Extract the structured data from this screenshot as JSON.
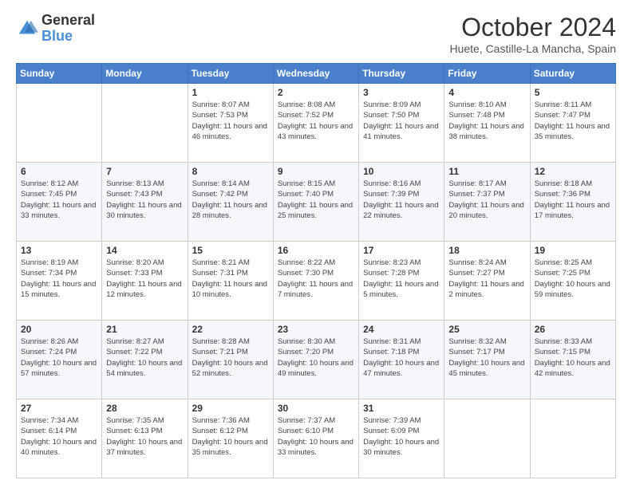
{
  "logo": {
    "general": "General",
    "blue": "Blue"
  },
  "header": {
    "month": "October 2024",
    "location": "Huete, Castille-La Mancha, Spain"
  },
  "weekdays": [
    "Sunday",
    "Monday",
    "Tuesday",
    "Wednesday",
    "Thursday",
    "Friday",
    "Saturday"
  ],
  "weeks": [
    [
      {
        "day": "",
        "info": ""
      },
      {
        "day": "",
        "info": ""
      },
      {
        "day": "1",
        "info": "Sunrise: 8:07 AM\nSunset: 7:53 PM\nDaylight: 11 hours and 46 minutes."
      },
      {
        "day": "2",
        "info": "Sunrise: 8:08 AM\nSunset: 7:52 PM\nDaylight: 11 hours and 43 minutes."
      },
      {
        "day": "3",
        "info": "Sunrise: 8:09 AM\nSunset: 7:50 PM\nDaylight: 11 hours and 41 minutes."
      },
      {
        "day": "4",
        "info": "Sunrise: 8:10 AM\nSunset: 7:48 PM\nDaylight: 11 hours and 38 minutes."
      },
      {
        "day": "5",
        "info": "Sunrise: 8:11 AM\nSunset: 7:47 PM\nDaylight: 11 hours and 35 minutes."
      }
    ],
    [
      {
        "day": "6",
        "info": "Sunrise: 8:12 AM\nSunset: 7:45 PM\nDaylight: 11 hours and 33 minutes."
      },
      {
        "day": "7",
        "info": "Sunrise: 8:13 AM\nSunset: 7:43 PM\nDaylight: 11 hours and 30 minutes."
      },
      {
        "day": "8",
        "info": "Sunrise: 8:14 AM\nSunset: 7:42 PM\nDaylight: 11 hours and 28 minutes."
      },
      {
        "day": "9",
        "info": "Sunrise: 8:15 AM\nSunset: 7:40 PM\nDaylight: 11 hours and 25 minutes."
      },
      {
        "day": "10",
        "info": "Sunrise: 8:16 AM\nSunset: 7:39 PM\nDaylight: 11 hours and 22 minutes."
      },
      {
        "day": "11",
        "info": "Sunrise: 8:17 AM\nSunset: 7:37 PM\nDaylight: 11 hours and 20 minutes."
      },
      {
        "day": "12",
        "info": "Sunrise: 8:18 AM\nSunset: 7:36 PM\nDaylight: 11 hours and 17 minutes."
      }
    ],
    [
      {
        "day": "13",
        "info": "Sunrise: 8:19 AM\nSunset: 7:34 PM\nDaylight: 11 hours and 15 minutes."
      },
      {
        "day": "14",
        "info": "Sunrise: 8:20 AM\nSunset: 7:33 PM\nDaylight: 11 hours and 12 minutes."
      },
      {
        "day": "15",
        "info": "Sunrise: 8:21 AM\nSunset: 7:31 PM\nDaylight: 11 hours and 10 minutes."
      },
      {
        "day": "16",
        "info": "Sunrise: 8:22 AM\nSunset: 7:30 PM\nDaylight: 11 hours and 7 minutes."
      },
      {
        "day": "17",
        "info": "Sunrise: 8:23 AM\nSunset: 7:28 PM\nDaylight: 11 hours and 5 minutes."
      },
      {
        "day": "18",
        "info": "Sunrise: 8:24 AM\nSunset: 7:27 PM\nDaylight: 11 hours and 2 minutes."
      },
      {
        "day": "19",
        "info": "Sunrise: 8:25 AM\nSunset: 7:25 PM\nDaylight: 10 hours and 59 minutes."
      }
    ],
    [
      {
        "day": "20",
        "info": "Sunrise: 8:26 AM\nSunset: 7:24 PM\nDaylight: 10 hours and 57 minutes."
      },
      {
        "day": "21",
        "info": "Sunrise: 8:27 AM\nSunset: 7:22 PM\nDaylight: 10 hours and 54 minutes."
      },
      {
        "day": "22",
        "info": "Sunrise: 8:28 AM\nSunset: 7:21 PM\nDaylight: 10 hours and 52 minutes."
      },
      {
        "day": "23",
        "info": "Sunrise: 8:30 AM\nSunset: 7:20 PM\nDaylight: 10 hours and 49 minutes."
      },
      {
        "day": "24",
        "info": "Sunrise: 8:31 AM\nSunset: 7:18 PM\nDaylight: 10 hours and 47 minutes."
      },
      {
        "day": "25",
        "info": "Sunrise: 8:32 AM\nSunset: 7:17 PM\nDaylight: 10 hours and 45 minutes."
      },
      {
        "day": "26",
        "info": "Sunrise: 8:33 AM\nSunset: 7:15 PM\nDaylight: 10 hours and 42 minutes."
      }
    ],
    [
      {
        "day": "27",
        "info": "Sunrise: 7:34 AM\nSunset: 6:14 PM\nDaylight: 10 hours and 40 minutes."
      },
      {
        "day": "28",
        "info": "Sunrise: 7:35 AM\nSunset: 6:13 PM\nDaylight: 10 hours and 37 minutes."
      },
      {
        "day": "29",
        "info": "Sunrise: 7:36 AM\nSunset: 6:12 PM\nDaylight: 10 hours and 35 minutes."
      },
      {
        "day": "30",
        "info": "Sunrise: 7:37 AM\nSunset: 6:10 PM\nDaylight: 10 hours and 33 minutes."
      },
      {
        "day": "31",
        "info": "Sunrise: 7:39 AM\nSunset: 6:09 PM\nDaylight: 10 hours and 30 minutes."
      },
      {
        "day": "",
        "info": ""
      },
      {
        "day": "",
        "info": ""
      }
    ]
  ]
}
